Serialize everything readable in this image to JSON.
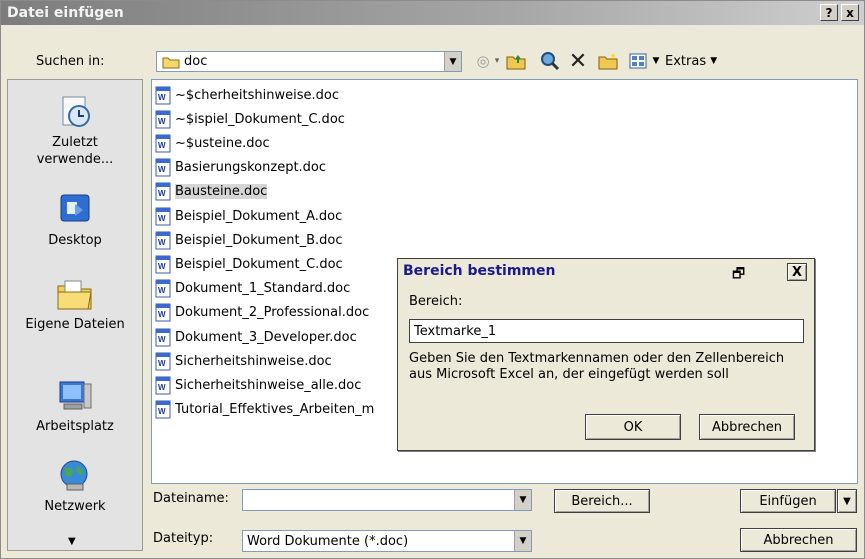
{
  "window": {
    "title": "Datei einfügen",
    "help_btn": "?",
    "close_btn": "x"
  },
  "lookin": {
    "label": "Suchen in:",
    "value": "doc",
    "extras_label": "Extras"
  },
  "sidebar": {
    "items": [
      {
        "label1": "Zuletzt",
        "label2": "verwende...",
        "icon": "recent-clock-icon"
      },
      {
        "label1": "Desktop",
        "label2": "",
        "icon": "desktop-icon"
      },
      {
        "label1": "Eigene Dateien",
        "label2": "",
        "icon": "my-documents-folder-icon"
      },
      {
        "label1": "Arbeitsplatz",
        "label2": "",
        "icon": "my-computer-icon"
      },
      {
        "label1": "Netzwerk",
        "label2": "",
        "icon": "network-globe-icon"
      }
    ]
  },
  "files": [
    "~$cherheitshinweise.doc",
    "~$ispiel_Dokument_C.doc",
    "~$usteine.doc",
    "Basierungskonzept.doc",
    "Bausteine.doc",
    "Beispiel_Dokument_A.doc",
    "Beispiel_Dokument_B.doc",
    "Beispiel_Dokument_C.doc",
    "Dokument_1_Standard.doc",
    "Dokument_2_Professional.doc",
    "Dokument_3_Developer.doc",
    "Sicherheitshinweise.doc",
    "Sicherheitshinweise_alle.doc",
    "Tutorial_Effektives_Arbeiten_m"
  ],
  "selected_file": "Bausteine.doc",
  "bottom": {
    "filename_label": "Dateiname:",
    "filename_value": "",
    "filetype_label": "Dateityp:",
    "filetype_value": "Word Dokumente (*.doc)",
    "range_button": "Bereich...",
    "insert_button": "Einfügen",
    "cancel_button": "Abbrechen"
  },
  "modal": {
    "title": "Bereich bestimmen",
    "field_label": "Bereich:",
    "field_value": "Textmarke_1",
    "description": "Geben Sie den Textmarkennamen oder den Zellenbereich aus Microsoft Excel an, der eingefügt werden soll",
    "ok_button": "OK",
    "cancel_button": "Abbrechen",
    "close_btn": "X"
  }
}
